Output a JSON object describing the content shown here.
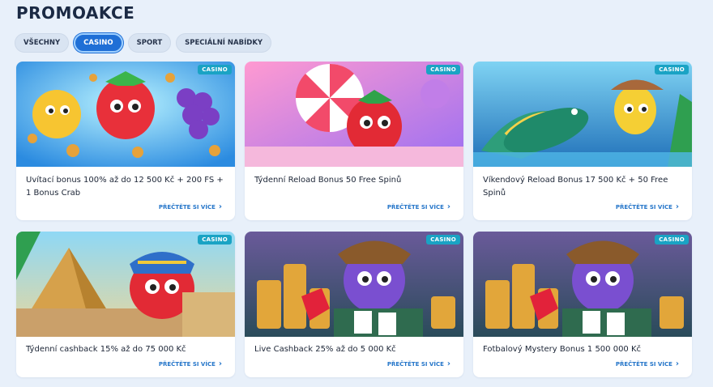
{
  "page": {
    "title": "PROMOAKCE"
  },
  "tabs": [
    {
      "label": "VŠECHNY",
      "active": false
    },
    {
      "label": "CASINO",
      "active": true
    },
    {
      "label": "SPORT",
      "active": false
    },
    {
      "label": "SPECIÁLNÍ NABÍDKY",
      "active": false
    }
  ],
  "cards": [
    {
      "badge": "CASINO",
      "title": "Uvítací bonus 100% až do 12 500 Kč + 200 FS + 1 Bonus Crab",
      "more": "PŘEČTĚTE SI VÍCE"
    },
    {
      "badge": "CASINO",
      "title": "Týdenní Reload Bonus 50 Free Spinů",
      "more": "PŘEČTĚTE SI VÍCE"
    },
    {
      "badge": "CASINO",
      "title": "Víkendový Reload Bonus 17 500 Kč + 50 Free Spinů",
      "more": "PŘEČTĚTE SI VÍCE"
    },
    {
      "badge": "CASINO",
      "title": "Týdenní cashback 15% až do 75 000 Kč",
      "more": "PŘEČTĚTE SI VÍCE"
    },
    {
      "badge": "CASINO",
      "title": "Live Cashback 25% až do 5 000 Kč",
      "more": "PŘEČTĚTE SI VÍCE"
    },
    {
      "badge": "CASINO",
      "title": "Fotbalový Mystery Bonus 1 500 000 Kč",
      "more": "PŘEČTĚTE SI VÍCE"
    }
  ],
  "colors": {
    "accent": "#1f6fd6",
    "badge": "#1aa3c4",
    "link": "#2475c9"
  }
}
